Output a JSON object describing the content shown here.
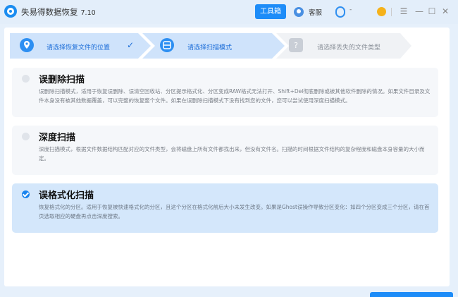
{
  "app": {
    "name": "失易得数据恢复",
    "version": "7.10"
  },
  "header": {
    "toolbox_label": "工具箱",
    "service_label": "客服",
    "user_label": "-"
  },
  "steps": [
    {
      "label": "请选择恢复文件的位置",
      "state": "done",
      "icon": "location-pin-icon"
    },
    {
      "label": "请选择扫描模式",
      "state": "active",
      "icon": "scan-icon"
    },
    {
      "label": "请选择丢失的文件类型",
      "state": "pending",
      "icon": "question-icon"
    }
  ],
  "options": [
    {
      "title": "误删除扫描",
      "desc": "误删除扫描模式，适用于恢复误删除、误清空回收站、分区提示格式化、分区变成RAW格式无法打开、Shift+Del彻底删除或被其他软件删除的情况。如果文件目录及文件本身没有被其他数据覆盖，可以完整的恢复整个文件。如果在误删除扫描模式下没有找到您的文件，您可以尝试使用深度扫描模式。",
      "selected": false
    },
    {
      "title": "深度扫描",
      "desc": "深度扫描模式，根据文件数据结构匹配对应的文件类型，会将磁盘上所有文件都找出来，但没有文件名。扫描的时间根据文件结构的复杂程度和磁盘本身容量的大小而定。",
      "selected": false
    },
    {
      "title": "误格式化扫描",
      "desc": "恢复格式化的分区。适用于恢复被快速格式化的分区，且这个分区在格式化前后大小未发生改变。如果是Ghost误操作导致分区变化：如四个分区变成三个分区，请在首页选取相应的硬盘再点击深度搜索。",
      "selected": true
    }
  ],
  "colors": {
    "accent": "#1d8cf8",
    "selected_bg": "#d4e7fb",
    "step_bar": "#cfe3fb"
  }
}
